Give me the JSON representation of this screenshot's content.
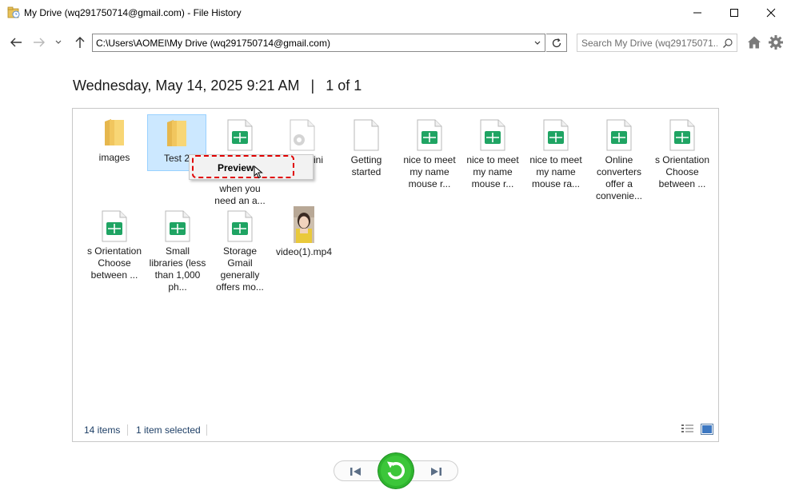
{
  "window": {
    "title": "My Drive (wq291750714@gmail.com) - File History"
  },
  "address": {
    "path": "C:\\Users\\AOMEI\\My Drive (wq291750714@gmail.com)",
    "search_placeholder": "Search My Drive (wq29175071..."
  },
  "header": {
    "date": "Wednesday, May 14, 2025 9:21 AM",
    "separator": "|",
    "position": "1 of 1"
  },
  "items": [
    {
      "label": "images",
      "icon": "folder-icon"
    },
    {
      "label": "Test 2",
      "icon": "folder-icon",
      "selected": true
    },
    {
      "label": "when you need an a...",
      "icon": "sheet-icon"
    },
    {
      "label": "p.ini",
      "icon": "settings-file-icon"
    },
    {
      "label": "Getting started",
      "icon": "blank-file-icon"
    },
    {
      "label": "nice to meet my name mouse r...",
      "icon": "sheet-icon"
    },
    {
      "label": "nice to meet my name mouse r...",
      "icon": "sheet-icon"
    },
    {
      "label": "nice to meet my name mouse ra...",
      "icon": "sheet-icon"
    },
    {
      "label": "Online converters offer a convenie...",
      "icon": "sheet-icon"
    },
    {
      "label": "s Orientation Choose between ...",
      "icon": "sheet-icon"
    },
    {
      "label": "s Orientation Choose between ...",
      "icon": "sheet-icon"
    },
    {
      "label": "Small libraries (less than 1,000 ph...",
      "icon": "sheet-icon"
    },
    {
      "label": "Storage Gmail generally offers mo...",
      "icon": "sheet-icon"
    },
    {
      "label": "video(1).mp4",
      "icon": "video-thumbnail-icon"
    }
  ],
  "context_menu": {
    "preview_label": "Preview"
  },
  "status": {
    "count": "14 items",
    "selection": "1 item selected"
  },
  "colors": {
    "selection_bg": "#cce8ff",
    "sheet_green": "#1fa463",
    "restore_green": "#2fb52f",
    "highlight_red": "#e00000",
    "folder_yellow": "#f8d675"
  }
}
